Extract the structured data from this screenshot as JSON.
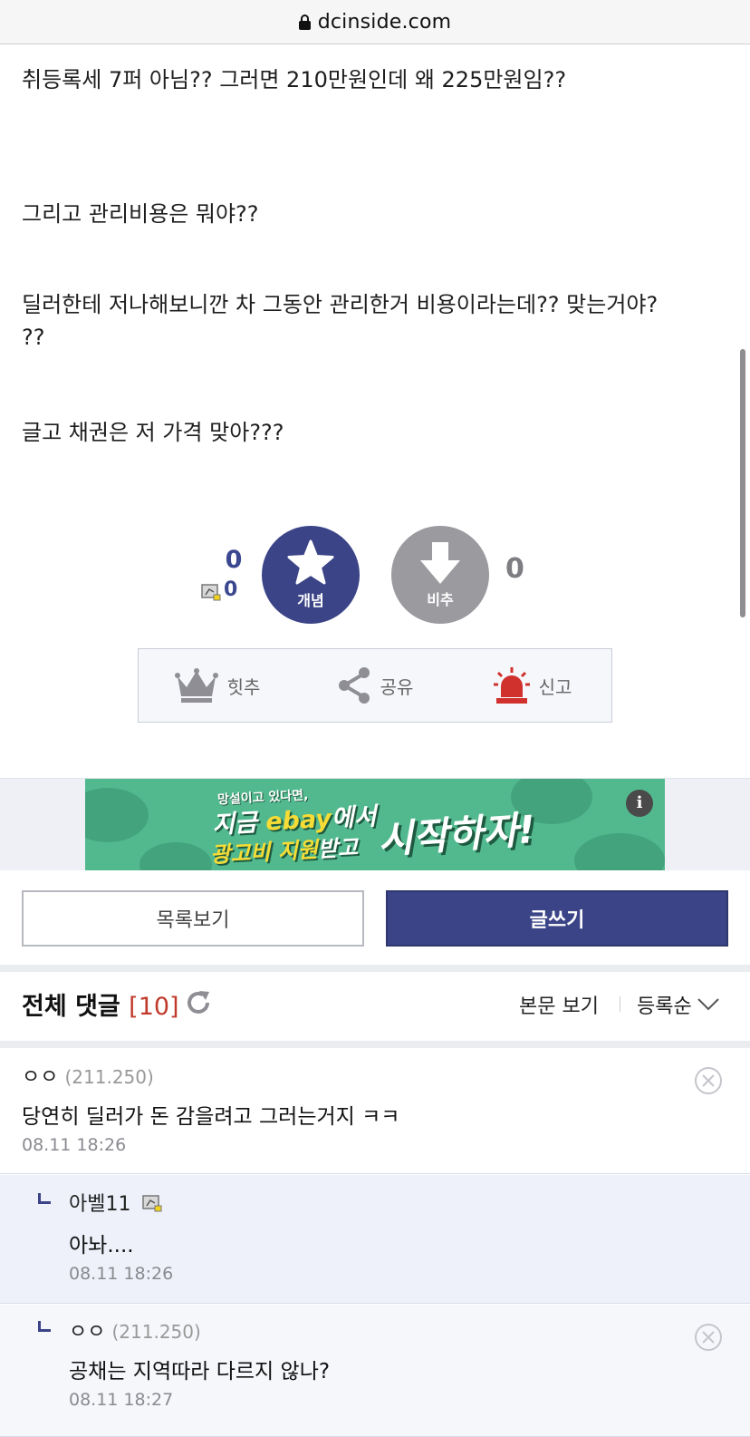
{
  "browser": {
    "url": "dcinside.com"
  },
  "post": {
    "lines": [
      "취등록세 7퍼 아님??   그러면 210만원인데 왜 225만원임??",
      "그리고 관리비용은 뭐야??",
      "딜러한테 저나해보니깐 차 그동안 관리한거 비용이라는데??  맞는거야?",
      "??",
      "글고 채권은 저 가격 맞아???"
    ]
  },
  "vote": {
    "up_count": "0",
    "fixed_count": "0",
    "up_label": "개념",
    "down_label": "비추",
    "down_count": "0",
    "colors": {
      "up": "#3b4487",
      "down": "#9a9a9f"
    }
  },
  "actions": [
    {
      "label": "힛추",
      "icon": "crown-icon"
    },
    {
      "label": "공유",
      "icon": "share-icon"
    },
    {
      "label": "신고",
      "icon": "siren-icon"
    }
  ],
  "ad": {
    "small": "망설이고 있다면,",
    "line1_a": "지금 ",
    "line1_b": "ebay",
    "line1_c": "에서",
    "line2_a": "광고비 지원",
    "line2_b": "받고",
    "big": "시작하자!",
    "info": "i"
  },
  "buttons": {
    "list": "목록보기",
    "write": "글쓰기"
  },
  "comments_header": {
    "title": "전체 댓글",
    "count": "[10]",
    "view_body": "본문 보기",
    "sort": "등록순"
  },
  "comments": [
    {
      "nick": "ㅇㅇ",
      "ip": "(211.250)",
      "text": "당연히 딜러가 돈 감을려고 그러는거지 ㅋㅋ",
      "date": "08.11 18:26"
    },
    {
      "nick": "아벨11",
      "ip": "",
      "text": "아놔....",
      "date": "08.11 18:26"
    },
    {
      "nick": "ㅇㅇ",
      "ip": "(211.250)",
      "text": "공채는 지역따라 다르지 않나?",
      "date": "08.11 18:27"
    }
  ]
}
